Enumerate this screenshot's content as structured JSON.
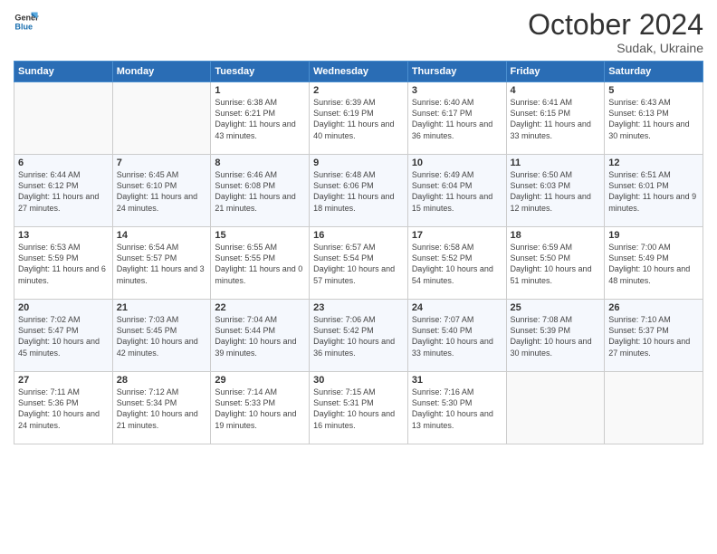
{
  "header": {
    "logo_general": "General",
    "logo_blue": "Blue",
    "month_year": "October 2024",
    "location": "Sudak, Ukraine"
  },
  "weekdays": [
    "Sunday",
    "Monday",
    "Tuesday",
    "Wednesday",
    "Thursday",
    "Friday",
    "Saturday"
  ],
  "weeks": [
    [
      {
        "day": "",
        "info": ""
      },
      {
        "day": "",
        "info": ""
      },
      {
        "day": "1",
        "info": "Sunrise: 6:38 AM\nSunset: 6:21 PM\nDaylight: 11 hours and 43 minutes."
      },
      {
        "day": "2",
        "info": "Sunrise: 6:39 AM\nSunset: 6:19 PM\nDaylight: 11 hours and 40 minutes."
      },
      {
        "day": "3",
        "info": "Sunrise: 6:40 AM\nSunset: 6:17 PM\nDaylight: 11 hours and 36 minutes."
      },
      {
        "day": "4",
        "info": "Sunrise: 6:41 AM\nSunset: 6:15 PM\nDaylight: 11 hours and 33 minutes."
      },
      {
        "day": "5",
        "info": "Sunrise: 6:43 AM\nSunset: 6:13 PM\nDaylight: 11 hours and 30 minutes."
      }
    ],
    [
      {
        "day": "6",
        "info": "Sunrise: 6:44 AM\nSunset: 6:12 PM\nDaylight: 11 hours and 27 minutes."
      },
      {
        "day": "7",
        "info": "Sunrise: 6:45 AM\nSunset: 6:10 PM\nDaylight: 11 hours and 24 minutes."
      },
      {
        "day": "8",
        "info": "Sunrise: 6:46 AM\nSunset: 6:08 PM\nDaylight: 11 hours and 21 minutes."
      },
      {
        "day": "9",
        "info": "Sunrise: 6:48 AM\nSunset: 6:06 PM\nDaylight: 11 hours and 18 minutes."
      },
      {
        "day": "10",
        "info": "Sunrise: 6:49 AM\nSunset: 6:04 PM\nDaylight: 11 hours and 15 minutes."
      },
      {
        "day": "11",
        "info": "Sunrise: 6:50 AM\nSunset: 6:03 PM\nDaylight: 11 hours and 12 minutes."
      },
      {
        "day": "12",
        "info": "Sunrise: 6:51 AM\nSunset: 6:01 PM\nDaylight: 11 hours and 9 minutes."
      }
    ],
    [
      {
        "day": "13",
        "info": "Sunrise: 6:53 AM\nSunset: 5:59 PM\nDaylight: 11 hours and 6 minutes."
      },
      {
        "day": "14",
        "info": "Sunrise: 6:54 AM\nSunset: 5:57 PM\nDaylight: 11 hours and 3 minutes."
      },
      {
        "day": "15",
        "info": "Sunrise: 6:55 AM\nSunset: 5:55 PM\nDaylight: 11 hours and 0 minutes."
      },
      {
        "day": "16",
        "info": "Sunrise: 6:57 AM\nSunset: 5:54 PM\nDaylight: 10 hours and 57 minutes."
      },
      {
        "day": "17",
        "info": "Sunrise: 6:58 AM\nSunset: 5:52 PM\nDaylight: 10 hours and 54 minutes."
      },
      {
        "day": "18",
        "info": "Sunrise: 6:59 AM\nSunset: 5:50 PM\nDaylight: 10 hours and 51 minutes."
      },
      {
        "day": "19",
        "info": "Sunrise: 7:00 AM\nSunset: 5:49 PM\nDaylight: 10 hours and 48 minutes."
      }
    ],
    [
      {
        "day": "20",
        "info": "Sunrise: 7:02 AM\nSunset: 5:47 PM\nDaylight: 10 hours and 45 minutes."
      },
      {
        "day": "21",
        "info": "Sunrise: 7:03 AM\nSunset: 5:45 PM\nDaylight: 10 hours and 42 minutes."
      },
      {
        "day": "22",
        "info": "Sunrise: 7:04 AM\nSunset: 5:44 PM\nDaylight: 10 hours and 39 minutes."
      },
      {
        "day": "23",
        "info": "Sunrise: 7:06 AM\nSunset: 5:42 PM\nDaylight: 10 hours and 36 minutes."
      },
      {
        "day": "24",
        "info": "Sunrise: 7:07 AM\nSunset: 5:40 PM\nDaylight: 10 hours and 33 minutes."
      },
      {
        "day": "25",
        "info": "Sunrise: 7:08 AM\nSunset: 5:39 PM\nDaylight: 10 hours and 30 minutes."
      },
      {
        "day": "26",
        "info": "Sunrise: 7:10 AM\nSunset: 5:37 PM\nDaylight: 10 hours and 27 minutes."
      }
    ],
    [
      {
        "day": "27",
        "info": "Sunrise: 7:11 AM\nSunset: 5:36 PM\nDaylight: 10 hours and 24 minutes."
      },
      {
        "day": "28",
        "info": "Sunrise: 7:12 AM\nSunset: 5:34 PM\nDaylight: 10 hours and 21 minutes."
      },
      {
        "day": "29",
        "info": "Sunrise: 7:14 AM\nSunset: 5:33 PM\nDaylight: 10 hours and 19 minutes."
      },
      {
        "day": "30",
        "info": "Sunrise: 7:15 AM\nSunset: 5:31 PM\nDaylight: 10 hours and 16 minutes."
      },
      {
        "day": "31",
        "info": "Sunrise: 7:16 AM\nSunset: 5:30 PM\nDaylight: 10 hours and 13 minutes."
      },
      {
        "day": "",
        "info": ""
      },
      {
        "day": "",
        "info": ""
      }
    ]
  ]
}
